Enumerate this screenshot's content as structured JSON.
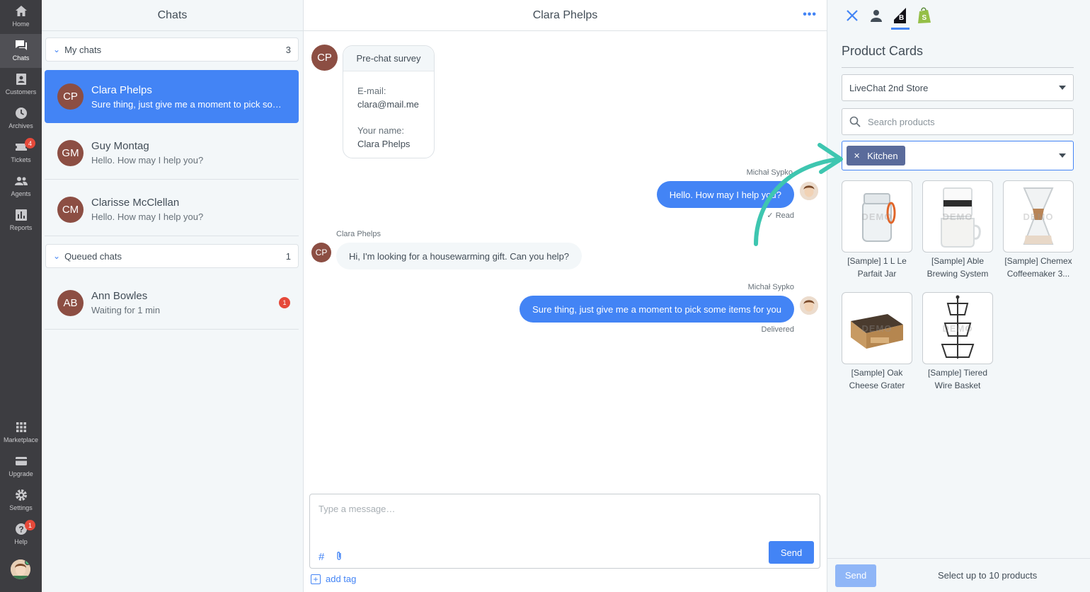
{
  "nav": {
    "items": [
      {
        "label": "Home",
        "icon": "home-icon"
      },
      {
        "label": "Chats",
        "icon": "chats-icon"
      },
      {
        "label": "Customers",
        "icon": "customers-icon"
      },
      {
        "label": "Archives",
        "icon": "archives-icon"
      },
      {
        "label": "Tickets",
        "icon": "tickets-icon",
        "badge": "4"
      },
      {
        "label": "Agents",
        "icon": "agents-icon"
      },
      {
        "label": "Reports",
        "icon": "reports-icon"
      },
      {
        "label": "Marketplace",
        "icon": "marketplace-icon"
      },
      {
        "label": "Upgrade",
        "icon": "upgrade-icon"
      },
      {
        "label": "Settings",
        "icon": "settings-icon"
      },
      {
        "label": "Help",
        "icon": "help-icon",
        "badge": "1"
      }
    ],
    "active": "Chats"
  },
  "list": {
    "title": "Chats",
    "my_chats": {
      "label": "My chats",
      "count": "3"
    },
    "chats": [
      {
        "initials": "CP",
        "name": "Clara Phelps",
        "preview": "Sure thing, just give me a moment to pick some items for you"
      },
      {
        "initials": "GM",
        "name": "Guy Montag",
        "preview": "Hello. How may I help you?"
      },
      {
        "initials": "CM",
        "name": "Clarisse McClellan",
        "preview": "Hello. How may I help you?"
      }
    ],
    "queued": {
      "label": "Queued chats",
      "count": "1"
    },
    "queued_chats": [
      {
        "initials": "AB",
        "name": "Ann Bowles",
        "preview": "Waiting for 1 min",
        "unread": "1"
      }
    ]
  },
  "conversation": {
    "title": "Clara Phelps",
    "menu": "•••",
    "survey": {
      "avatar": "CP",
      "title": "Pre-chat survey",
      "email_label": "E-mail:",
      "email_value": "clara@mail.me",
      "name_label": "Your name:",
      "name_value": "Clara Phelps"
    },
    "messages": [
      {
        "sender": "Michał Sypko",
        "text": "Hello. How may I help you?",
        "status": "Read"
      },
      {
        "sender": "Clara Phelps",
        "avatar": "CP",
        "text": "Hi, I'm looking for a housewarming gift. Can you help?"
      },
      {
        "sender": "Michał Sypko",
        "text": "Sure thing, just give me a moment to pick some items for you",
        "status": "Delivered"
      }
    ],
    "composer": {
      "placeholder": "Type a message…",
      "send": "Send"
    },
    "add_tag": "add tag"
  },
  "panel": {
    "title": "Product Cards",
    "store": "LiveChat 2nd Store",
    "search_placeholder": "Search products",
    "category_chip": "Kitchen",
    "products": [
      {
        "name": "[Sample] 1 L Le Parfait Jar"
      },
      {
        "name": "[Sample] Able Brewing System"
      },
      {
        "name": "[Sample] Chemex Coffeemaker 3..."
      },
      {
        "name": "[Sample] Oak Cheese Grater"
      },
      {
        "name": "[Sample] Tiered Wire Basket"
      }
    ],
    "demo_watermark": "DEMO",
    "send": "Send",
    "hint": "Select up to 10 products"
  },
  "colors": {
    "accent": "#4384f5",
    "nav_bg": "#3d3d41",
    "avatar": "#8c4e43",
    "badge": "#e5493a",
    "arrow": "#3ec6b0"
  }
}
